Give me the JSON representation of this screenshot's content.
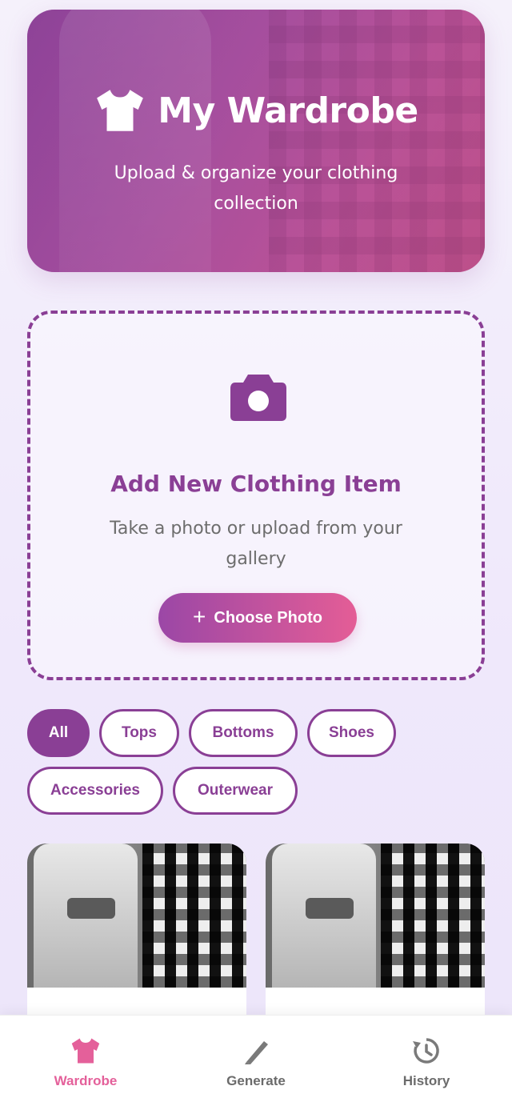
{
  "hero": {
    "title": "My Wardrobe",
    "subtitle": "Upload & organize your clothing collection",
    "icon": "tshirt-icon"
  },
  "upload": {
    "icon": "camera-icon",
    "title": "Add New Clothing Item",
    "description": "Take a photo or upload from your gallery",
    "button_label": "Choose Photo",
    "button_icon": "plus-icon"
  },
  "filters": [
    {
      "label": "All",
      "active": true
    },
    {
      "label": "Tops",
      "active": false
    },
    {
      "label": "Bottoms",
      "active": false
    },
    {
      "label": "Shoes",
      "active": false
    },
    {
      "label": "Accessories",
      "active": false
    },
    {
      "label": "Outerwear",
      "active": false
    }
  ],
  "nav": {
    "items": [
      {
        "label": "Wardrobe",
        "icon": "tshirt-icon",
        "active": true
      },
      {
        "label": "Generate",
        "icon": "wand-icon",
        "active": false
      },
      {
        "label": "History",
        "icon": "history-icon",
        "active": false
      }
    ]
  },
  "colors": {
    "primary": "#8a3f95",
    "accent_pink": "#e4609a",
    "background": "#f1ebfb"
  }
}
